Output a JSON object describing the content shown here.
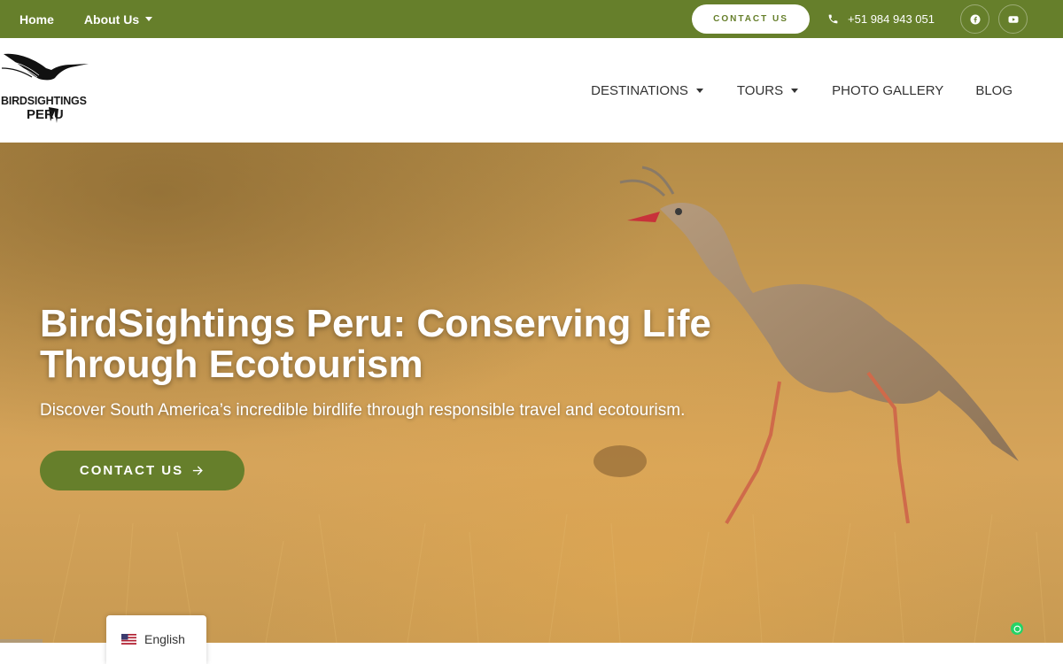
{
  "topbar": {
    "links": [
      {
        "label": "Home"
      },
      {
        "label": "About Us"
      }
    ],
    "contact_button": "CONTACT US",
    "phone": "+51 984 943 051",
    "social": [
      {
        "icon": "facebook-icon"
      },
      {
        "icon": "youtube-icon"
      }
    ],
    "background": "#667f2b"
  },
  "header": {
    "logo_line1": "BIRDSIGHTINGS",
    "logo_line2": "PERU",
    "nav": [
      {
        "label": "DESTINATIONS",
        "has_dropdown": true
      },
      {
        "label": "TOURS",
        "has_dropdown": true
      },
      {
        "label": "PHOTO GALLERY",
        "has_dropdown": false
      },
      {
        "label": "BLOG",
        "has_dropdown": false
      }
    ]
  },
  "hero": {
    "title": "BirdSightings Peru: Conserving Life Through Ecotourism",
    "subtitle": "Discover South America’s incredible birdlife through responsible travel and ecotourism.",
    "button_label": "CONTACT US",
    "button_icon": "arrow-right-icon",
    "accent": "#667f2b"
  },
  "language": {
    "label": "English",
    "flag_icon": "us-flag-icon"
  },
  "chat": {
    "icon": "whatsapp-icon",
    "color": "#25d366"
  }
}
